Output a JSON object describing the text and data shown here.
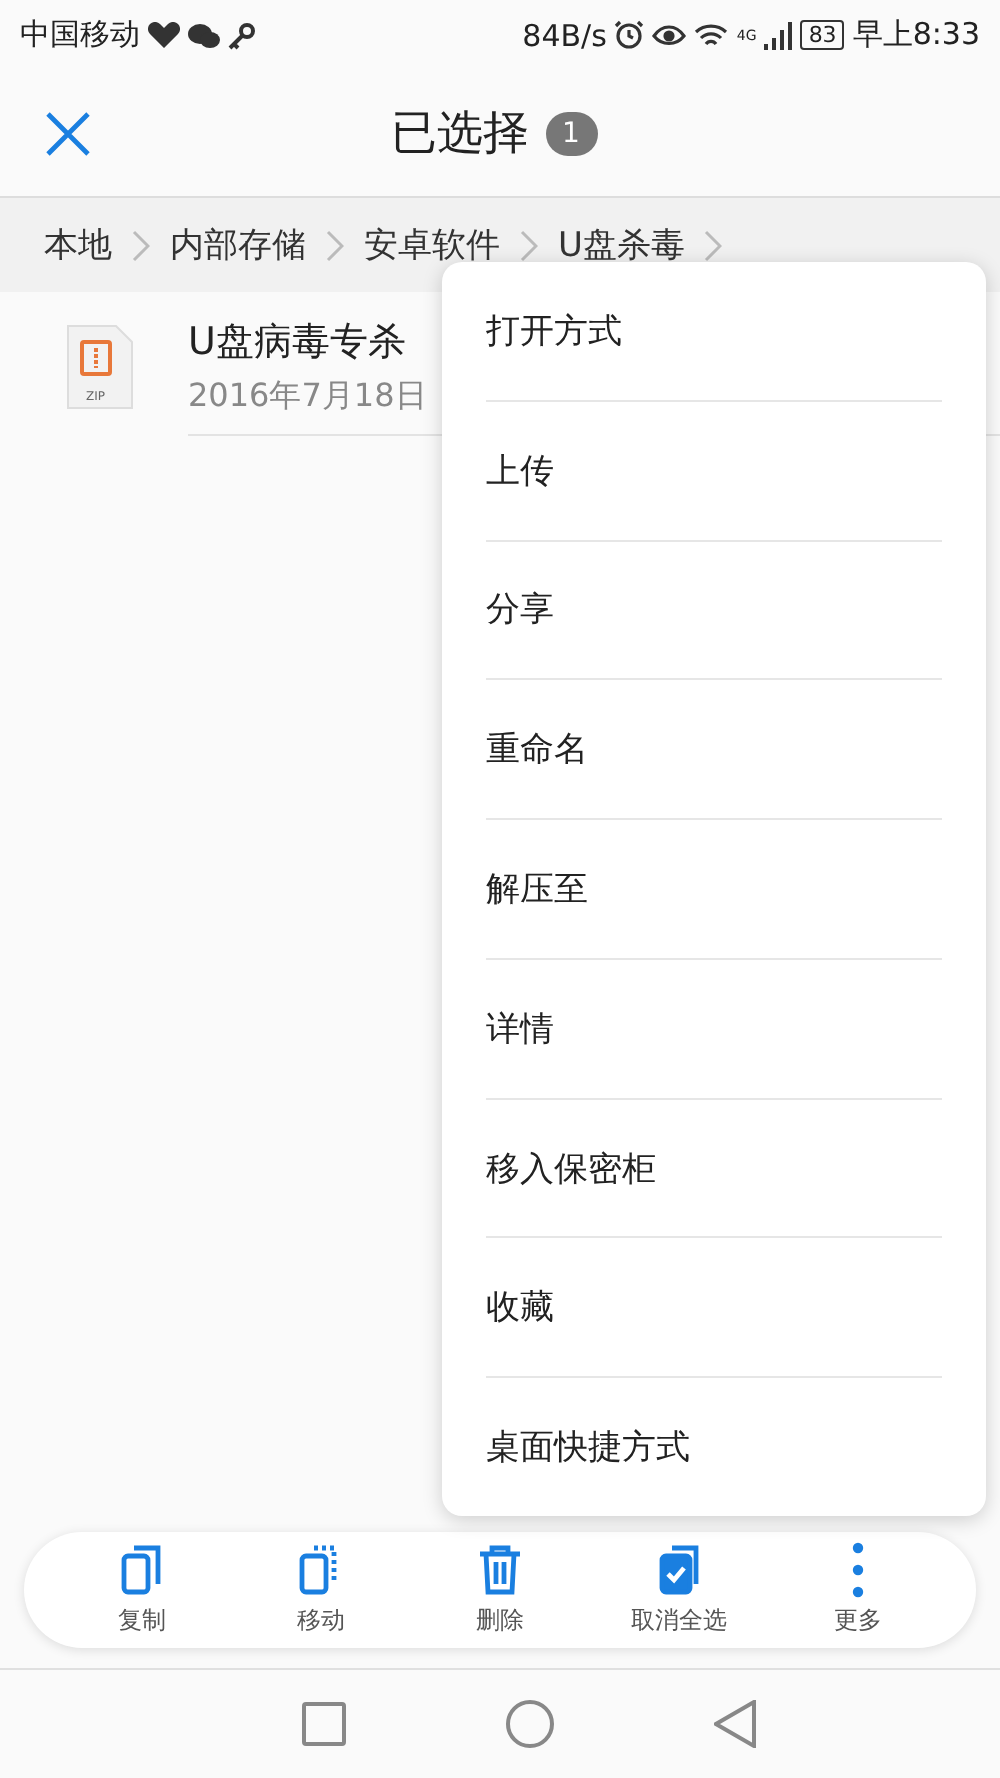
{
  "status_bar": {
    "carrier": "中国移动",
    "speed": "84B/s",
    "network": "4G",
    "battery": "83",
    "time": "早上8:33"
  },
  "header": {
    "title": "已选择",
    "count": "1"
  },
  "breadcrumb": [
    "本地",
    "内部存储",
    "安卓软件",
    "U盘杀毒"
  ],
  "files": [
    {
      "name": "U盘病毒专杀",
      "date": "2016年7月18日",
      "type": "ZIP"
    }
  ],
  "menu": [
    "打开方式",
    "上传",
    "分享",
    "重命名",
    "解压至",
    "详情",
    "移入保密柜",
    "收藏",
    "桌面快捷方式"
  ],
  "toolbar": [
    {
      "kind": "copy",
      "label": "复制"
    },
    {
      "kind": "move",
      "label": "移动"
    },
    {
      "kind": "delete",
      "label": "删除"
    },
    {
      "kind": "deselect",
      "label": "取消全选"
    },
    {
      "kind": "more",
      "label": "更多"
    }
  ]
}
